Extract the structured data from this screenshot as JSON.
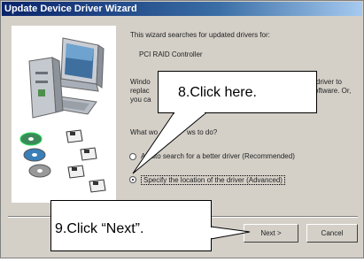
{
  "window": {
    "title": "Update Device Driver Wizard"
  },
  "content": {
    "intro": "This wizard searches for updated drivers for:",
    "device": "PCI RAID Controller",
    "para_line1": "Windo",
    "para_line1_tail": "driver to",
    "para_line2": "replac",
    "para_line2_tail": "software. Or,",
    "para_line3": "you ca",
    "question": "What wo",
    "question_tail": "ws to do?",
    "radio_auto_label": "A  auto  search for a better driver (Recommended)",
    "radio_specify_label": "Specify the location of the driver (Advanced)"
  },
  "buttons": {
    "next": "Next >",
    "cancel": "Cancel"
  },
  "callouts": {
    "click_here": "8.Click here.",
    "click_next": "9.Click “Next”."
  },
  "radio_state": {
    "auto": false,
    "specify": true
  },
  "colors": {
    "titlebar": "#0a246a",
    "dialog_bg": "#d4d0c8",
    "callout_bg": "#ffffff"
  }
}
